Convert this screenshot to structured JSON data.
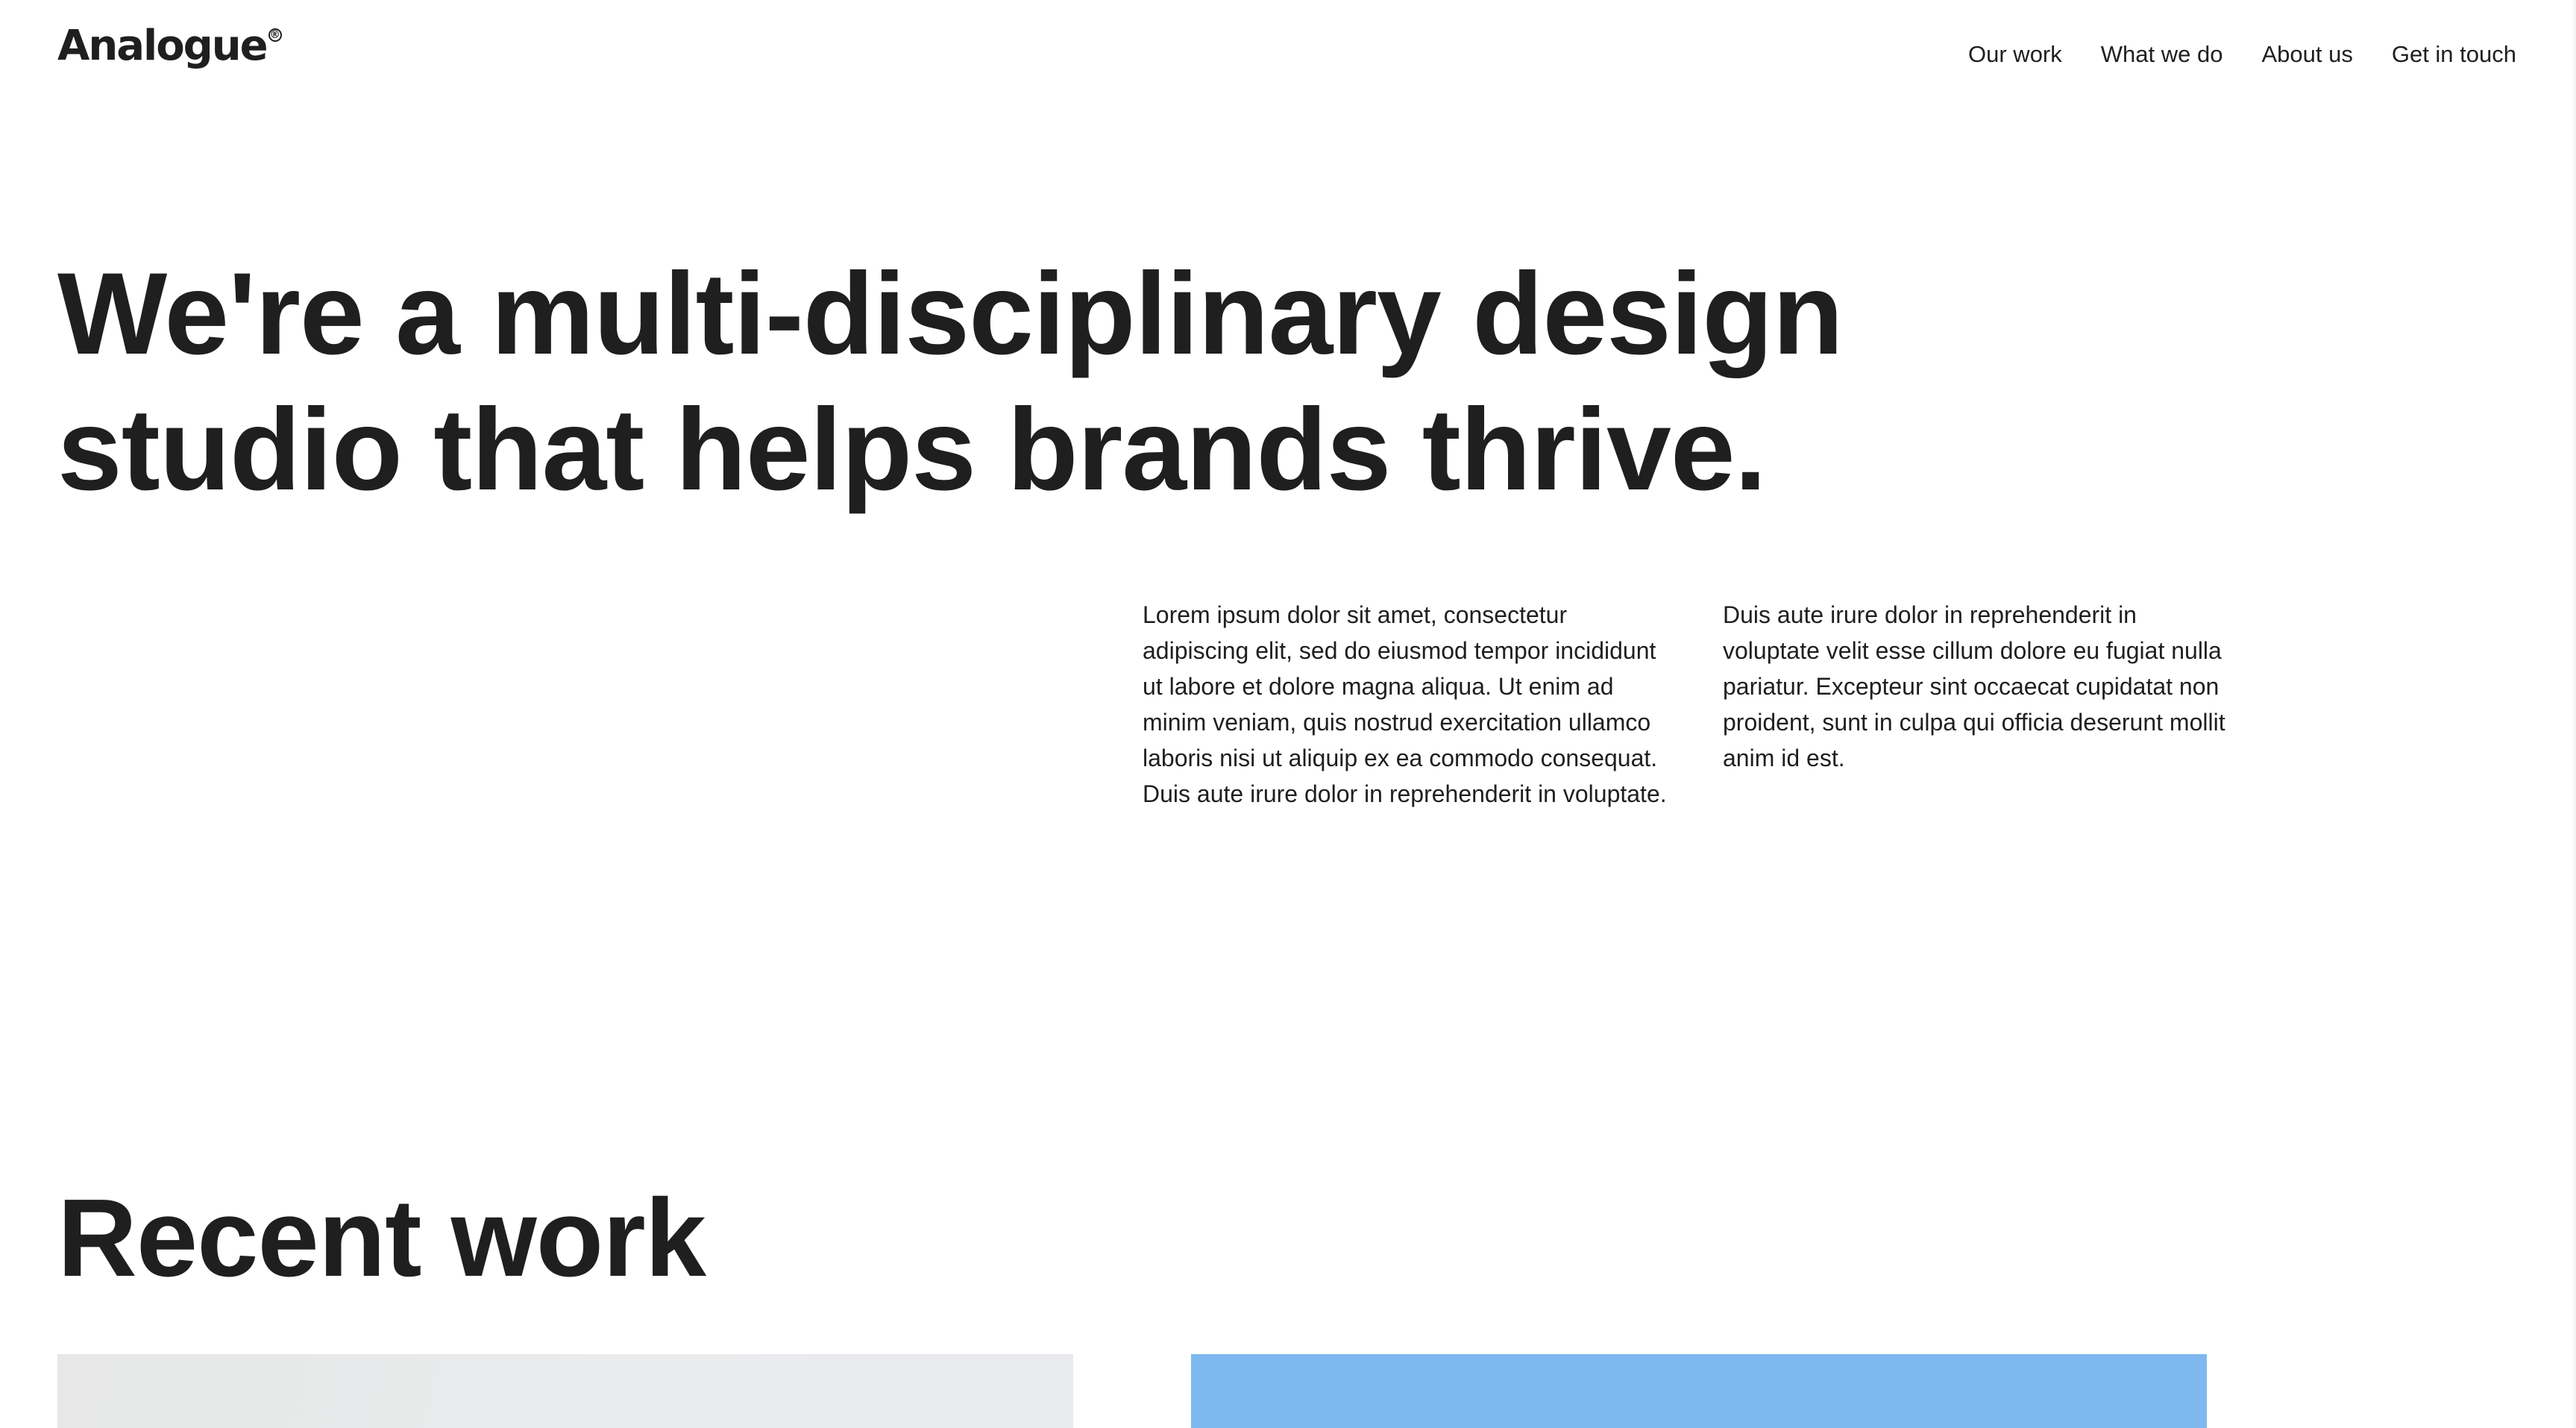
{
  "brand": {
    "name": "Analogue",
    "mark": "®"
  },
  "nav": {
    "items": [
      {
        "label": "Our work"
      },
      {
        "label": "What we do"
      },
      {
        "label": "About us"
      },
      {
        "label": "Get in touch"
      }
    ]
  },
  "hero": {
    "line1": "We're a multi-disciplinary design",
    "line2": "studio that helps brands thrive.",
    "paragraph1": "Lorem ipsum dolor sit amet, consectetur adipiscing elit, sed do eiusmod tempor incididunt ut labore et dolore magna aliqua. Ut enim ad minim veniam, quis nostrud exercitation ullamco laboris nisi ut aliquip ex ea commodo consequat. Duis aute irure dolor in reprehenderit in voluptate.",
    "paragraph2": "Duis aute irure dolor in reprehenderit in voluptate velit esse cillum dolore eu fugiat nulla pariatur. Excepteur sint occaecat cupidatat non proident, sunt in culpa qui officia deserunt mollit anim id est."
  },
  "recent_work": {
    "title": "Recent work",
    "cards": [
      {
        "color": "#e8eaec"
      },
      {
        "color": "#7db8ee"
      }
    ]
  }
}
